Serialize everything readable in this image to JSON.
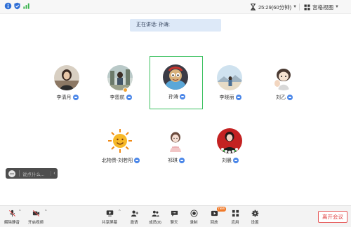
{
  "top_bar": {
    "timer_text": "25:29(60分钟)",
    "view_label": "宫格视图",
    "icons": [
      "info-icon",
      "shield-icon",
      "signal-icon",
      "hourglass-icon",
      "grid-icon"
    ]
  },
  "speaking": {
    "text": "正在讲话: 孙涛;"
  },
  "participants": [
    {
      "name": "李清月",
      "icon": "camera-icon"
    },
    {
      "name": "李恩航",
      "icon": "camera-icon",
      "avatar_badge": "host-badge-icon"
    },
    {
      "name": "孙涛",
      "icon": "camera-icon",
      "active": true
    },
    {
      "name": "李晓丽",
      "icon": "camera-icon"
    },
    {
      "name": "刘乙",
      "icon": "camera-icon"
    },
    {
      "name": "北物贵-刘若阳",
      "icon": "camera-icon"
    },
    {
      "name": "祁琪",
      "icon": "camera-icon"
    },
    {
      "name": "刘晨",
      "icon": "camera-icon"
    }
  ],
  "chat": {
    "placeholder": "说点什么..."
  },
  "toolbar": {
    "unmute": "解除静音",
    "start_video": "开启视频",
    "share_screen": "共享屏幕",
    "invite": "邀请",
    "members": "成员(8)",
    "chat": "聊天",
    "record": "录制",
    "replay": "回放",
    "apps": "应用",
    "settings": "设置",
    "leave": "离开会议",
    "replay_badge": "new"
  },
  "colors": {
    "active_border": "#3cc160",
    "accent": "#4a86e8",
    "leave": "#e04545",
    "banner": "#dde9f8"
  }
}
